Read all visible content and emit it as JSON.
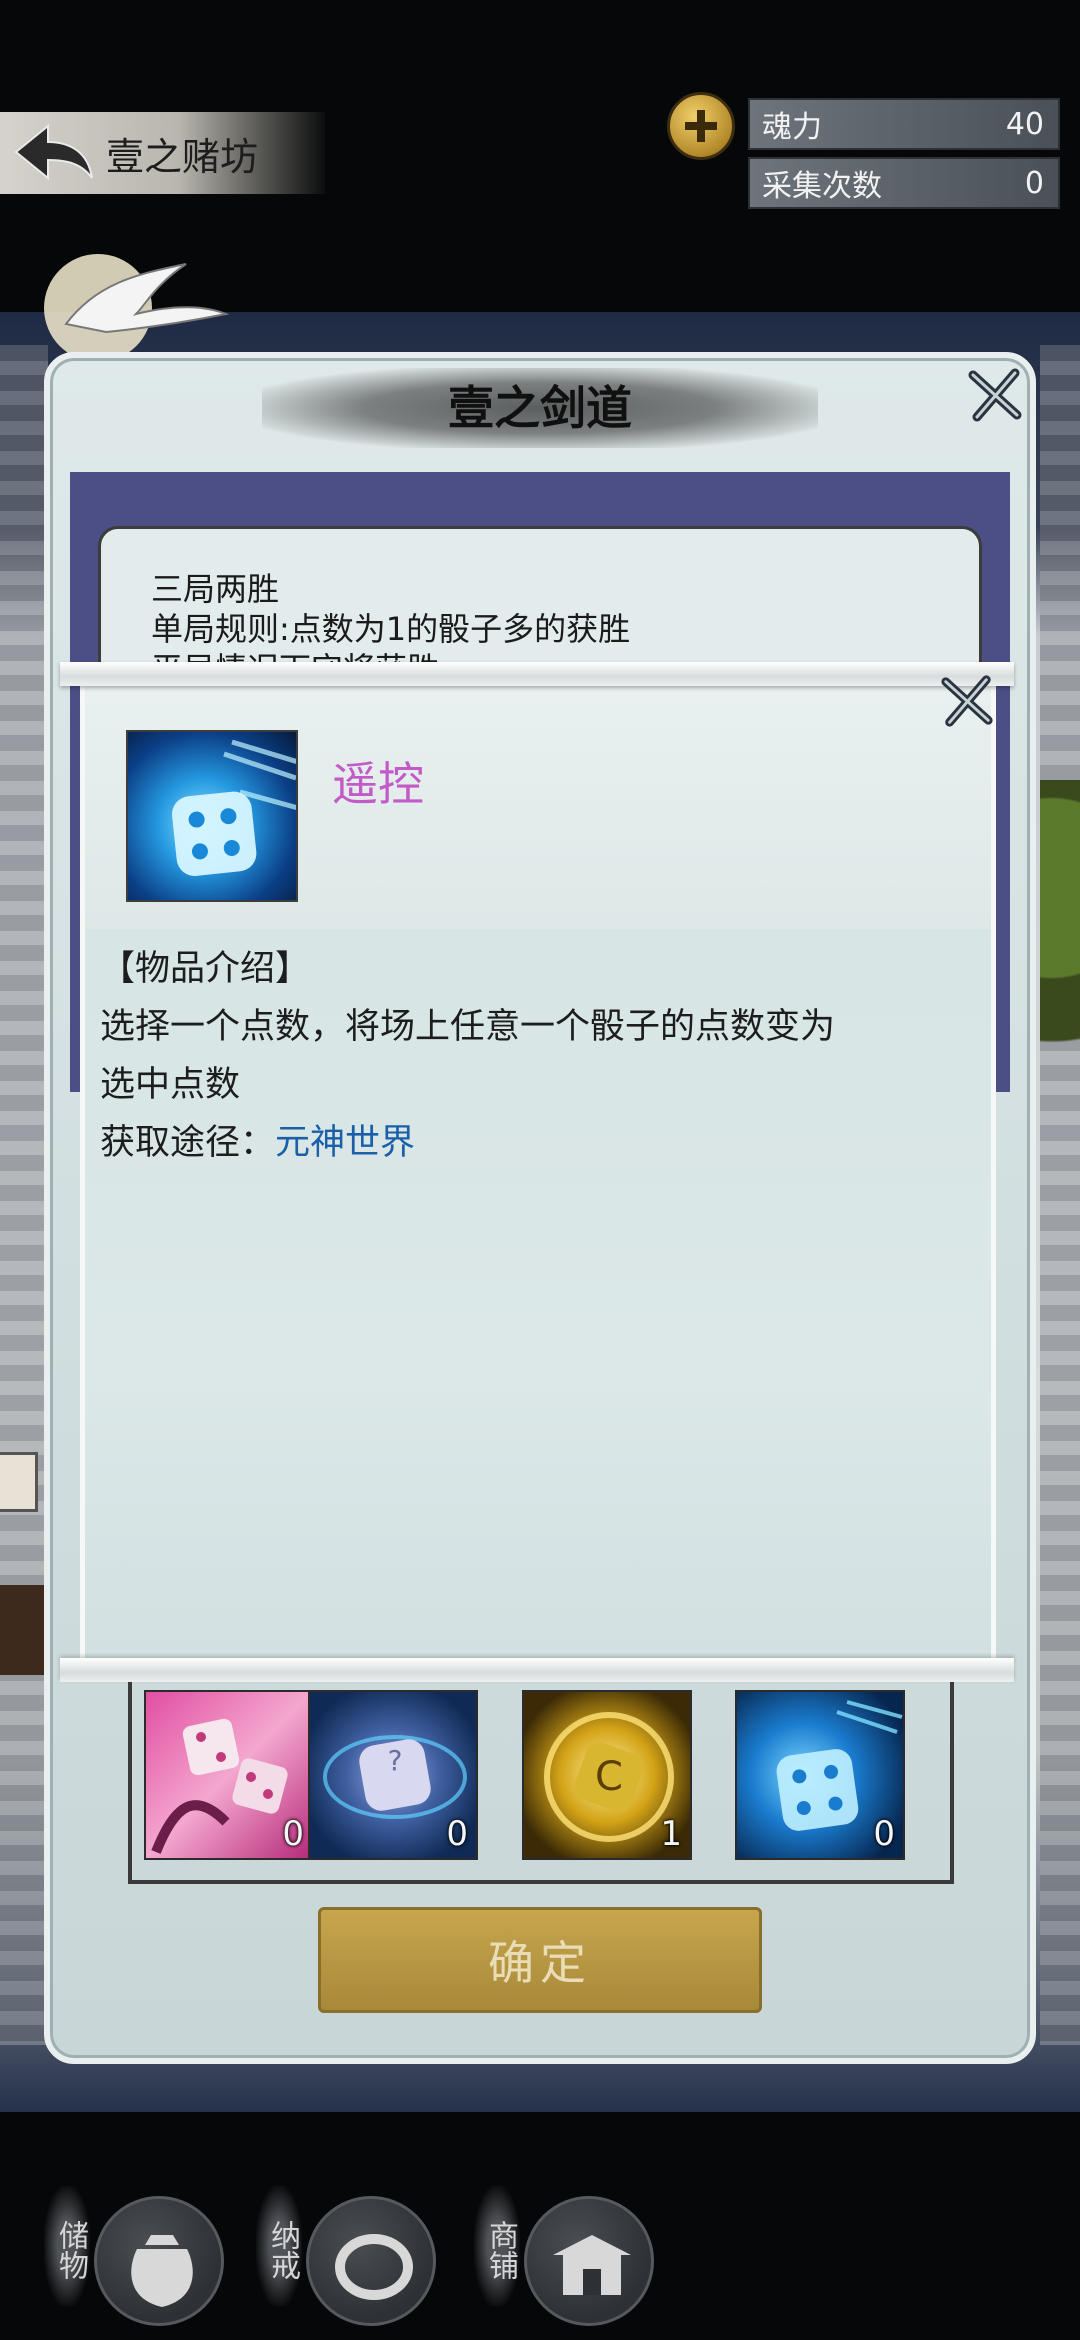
{
  "top_bar": {
    "back_label": "壹之赌坊",
    "plus_icon": "plus-icon",
    "stats": [
      {
        "label": "魂力",
        "value": "40"
      },
      {
        "label": "采集次数",
        "value": "0"
      }
    ]
  },
  "dialog": {
    "title": "壹之剑道",
    "rules": [
      "三局两胜",
      "单局规则:点数为1的骰子多的获胜",
      "平局情况下守将获胜"
    ],
    "items": [
      {
        "icon": "pink-dice-icon",
        "count": "0"
      },
      {
        "icon": "mystery-dice-icon",
        "count": "0"
      },
      {
        "icon": "golden-dice-icon",
        "count": "1"
      },
      {
        "icon": "blue-dice-icon",
        "count": "0"
      }
    ],
    "confirm_label": "确定"
  },
  "popup": {
    "item_name": "遥控",
    "intro_header": "【物品介绍】",
    "desc_line1": "选择一个点数，将场上任意一个骰子的点数变为",
    "desc_line2": "选中点数",
    "source_label": "获取途径：",
    "source_value": "元神世界"
  },
  "bottom_nav": [
    {
      "label": "储物",
      "icon": "bag-icon"
    },
    {
      "label": "纳戒",
      "icon": "ring-icon"
    },
    {
      "label": "商铺",
      "icon": "shop-icon"
    }
  ],
  "colors": {
    "item_name": "#c25ac8",
    "link": "#1a5fa8",
    "confirm_bg": "#b8973f"
  }
}
